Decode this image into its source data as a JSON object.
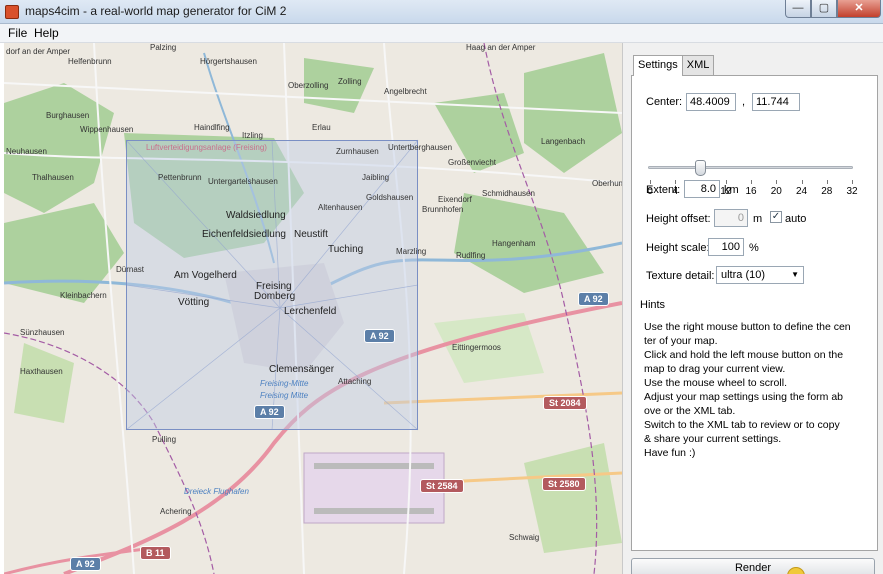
{
  "window": {
    "title": "maps4cim - a real-world map generator for CiM 2",
    "buttons": {
      "minimize": "—",
      "maximize": "▢",
      "close": "✕"
    }
  },
  "menu": {
    "items": [
      "File",
      "Help"
    ]
  },
  "map": {
    "towns": [
      "dorf an der Amper",
      "Palzing",
      "Helfenbrunn",
      "Hörgertshausen",
      "Oberzolling",
      "Zolling",
      "Angelbrecht",
      "Haag an der Amper",
      "Burghausen",
      "Wippenhausen",
      "Haindlfing",
      "Itzling",
      "Erlau",
      "Neuhausen",
      "Zurnhausen",
      "Untertberghausen",
      "Langenbach",
      "Großenviecht",
      "Thalhausen",
      "Pettenbrunn",
      "Untergartelshausen",
      "Jaibling",
      "Oberhummel",
      "Goldshausen",
      "Schmidhausen",
      "Eixendorf",
      "Brunnhofen",
      "Altenhausen",
      "Waldsiedlung",
      "Eichenfeldsiedlung",
      "Neustift",
      "Hangenham",
      "Tuching",
      "Marzling",
      "Rudlfing",
      "Dürnast",
      "Am Vogelherd",
      "Freising",
      "Domberg",
      "Kleinbachern",
      "Vötting",
      "Lerchenfeld",
      "Sünzhausen",
      "Eittingermoos",
      "Clemensänger",
      "Haxthausen",
      "Attaching",
      "Pulling",
      "Achering",
      "Schwaig"
    ],
    "road_shields": [
      "A 92",
      "A 92",
      "A 92",
      "A 92",
      "St 2084",
      "St 2584",
      "St 2580",
      "B 11"
    ],
    "water_labels": [
      "Freising-Mitte",
      "Freising Mitte",
      "Dreieck Flughafen"
    ],
    "restricted_area_label": "Luftverteidigungsanlage (Freising)"
  },
  "panel": {
    "tabs": [
      "Settings",
      "XML"
    ],
    "center_label": "Center:",
    "center_lat": "48.4009",
    "center_sep": ",",
    "center_lon": "11.744",
    "zoom_ticks": [
      "0",
      "4",
      "8",
      "12",
      "16",
      "20",
      "24",
      "28",
      "32"
    ],
    "zoom_value": 8,
    "extent_label": "Extent:",
    "extent_value": "8.0",
    "extent_unit": "km",
    "height_offset_label": "Height offset:",
    "height_offset_value": "0",
    "height_offset_unit": "m",
    "auto_label": "auto",
    "auto_checked": "✓",
    "height_scale_label": "Height scale:",
    "height_scale_value": "100",
    "height_scale_unit": "%",
    "texture_label": "Texture detail:",
    "texture_value": "ultra (10)",
    "hints_title": "Hints",
    "hints": [
      "Use the right mouse button to define the cen",
      "ter of your map.",
      "Click and hold the left mouse button on the",
      "map to drag your current view.",
      "Use the mouse wheel to scroll.",
      "Adjust your map settings using the form ab",
      "ove or the XML tab.",
      "Switch to the XML tab to review or to copy",
      "& share your current settings.",
      "Have fun :)"
    ],
    "render_label": "Render"
  },
  "colors": {
    "forest": "#a9cf93",
    "water": "#b5d0d0",
    "road": "#f7f7f7",
    "motorway": "#e892a2",
    "selection": "#bccde6"
  }
}
